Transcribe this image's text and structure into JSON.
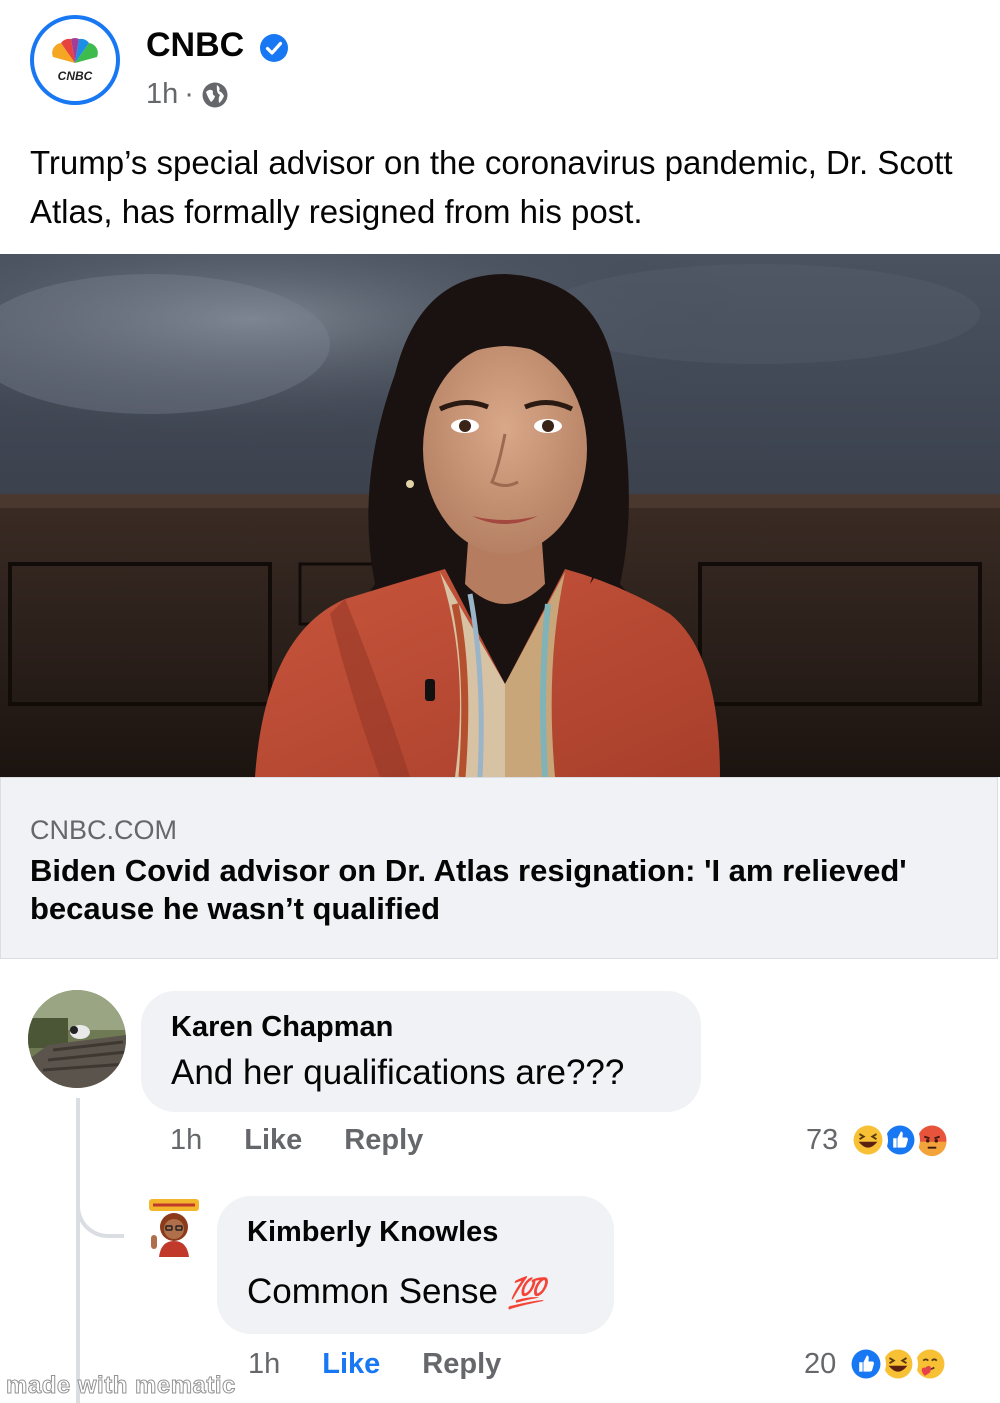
{
  "post": {
    "page_name": "CNBC",
    "logo_text": "CNBC",
    "time": "1h",
    "separator": "·",
    "text": "Trump’s special advisor on the coronavirus pandemic, Dr. Scott Atlas, has formally resigned from his post.",
    "link_domain": "CNBC.COM",
    "link_title": "Biden Covid advisor on Dr. Atlas resignation: 'I am relieved' because he wasn’t qualified"
  },
  "comments": [
    {
      "author": "Karen Chapman",
      "text": "And her qualifications are???",
      "time": "1h",
      "like": "Like",
      "reply": "Reply",
      "reaction_count": "73",
      "reactions": [
        "haha-icon",
        "like-icon",
        "angry-icon"
      ]
    },
    {
      "author": "Kimberly Knowles",
      "text": "Common Sense",
      "emoji": "💯",
      "time": "1h",
      "like": "Like",
      "reply": "Reply",
      "reaction_count": "20",
      "reactions": [
        "like-icon",
        "haha-icon",
        "care-icon"
      ]
    }
  ],
  "watermark": "made with mematic",
  "colors": {
    "accent": "#1877f2",
    "secondary_text": "#65676b",
    "bubble": "#f0f2f5"
  }
}
